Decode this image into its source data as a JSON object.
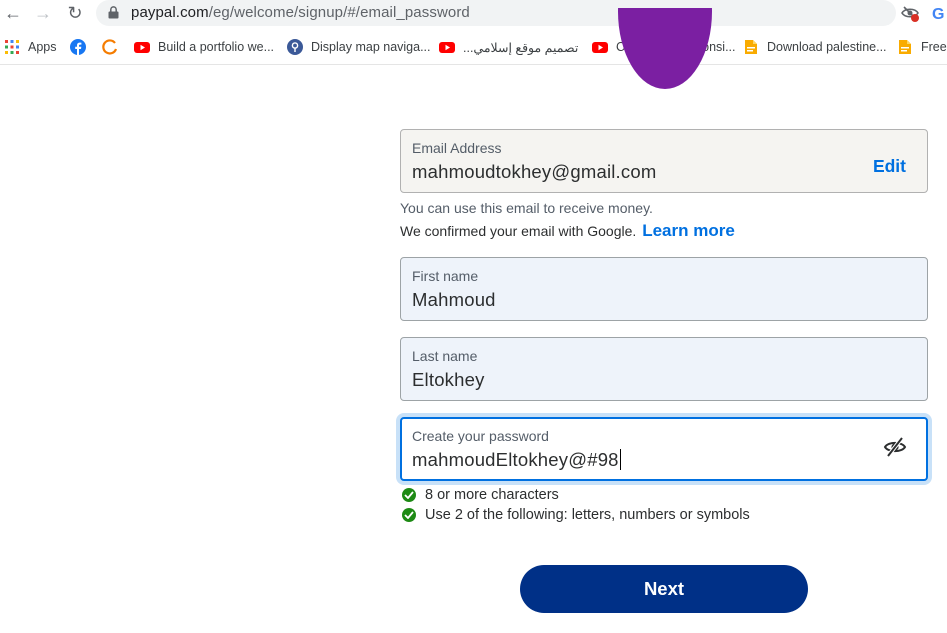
{
  "browser": {
    "url_host": "paypal.com",
    "url_path": "/eg/welcome/signup/#/email_password",
    "bookmarks": [
      {
        "label": "Apps",
        "icon": "apps-grid-icon"
      },
      {
        "label": "",
        "icon": "facebook-icon"
      },
      {
        "label": "",
        "icon": "orange-ring-icon"
      },
      {
        "label": "Build a portfolio we...",
        "icon": "youtube-icon"
      },
      {
        "label": "Display map naviga...",
        "icon": "map-pin-icon"
      },
      {
        "label": "تصميم موقع إسلامي...",
        "icon": "youtube-icon"
      },
      {
        "label": "Complete Responsi...",
        "icon": "youtube-icon"
      },
      {
        "label": "Download palestine...",
        "icon": "file-icon"
      },
      {
        "label": "Free",
        "icon": "file-icon"
      }
    ]
  },
  "form": {
    "email": {
      "label": "Email Address",
      "value": "mahmoudtokhey@gmail.com",
      "edit_label": "Edit"
    },
    "email_note": "You can use this email to receive money.",
    "google_note": "We confirmed your email with Google.",
    "learn_more": "Learn more",
    "first_name": {
      "label": "First name",
      "value": "Mahmoud"
    },
    "last_name": {
      "label": "Last name",
      "value": "Eltokhey"
    },
    "password": {
      "label": "Create your password",
      "value": "mahmoudEltokhey@#98"
    },
    "rules": [
      {
        "text": "8 or more characters",
        "met": true
      },
      {
        "text": "Use 2 of the following: letters, numbers or symbols",
        "met": true
      }
    ],
    "next_label": "Next"
  },
  "colors": {
    "brand_blue": "#003087",
    "link_blue": "#0070e0",
    "check_green": "#1d8a14",
    "avatar_purple": "#7b1fa2"
  }
}
